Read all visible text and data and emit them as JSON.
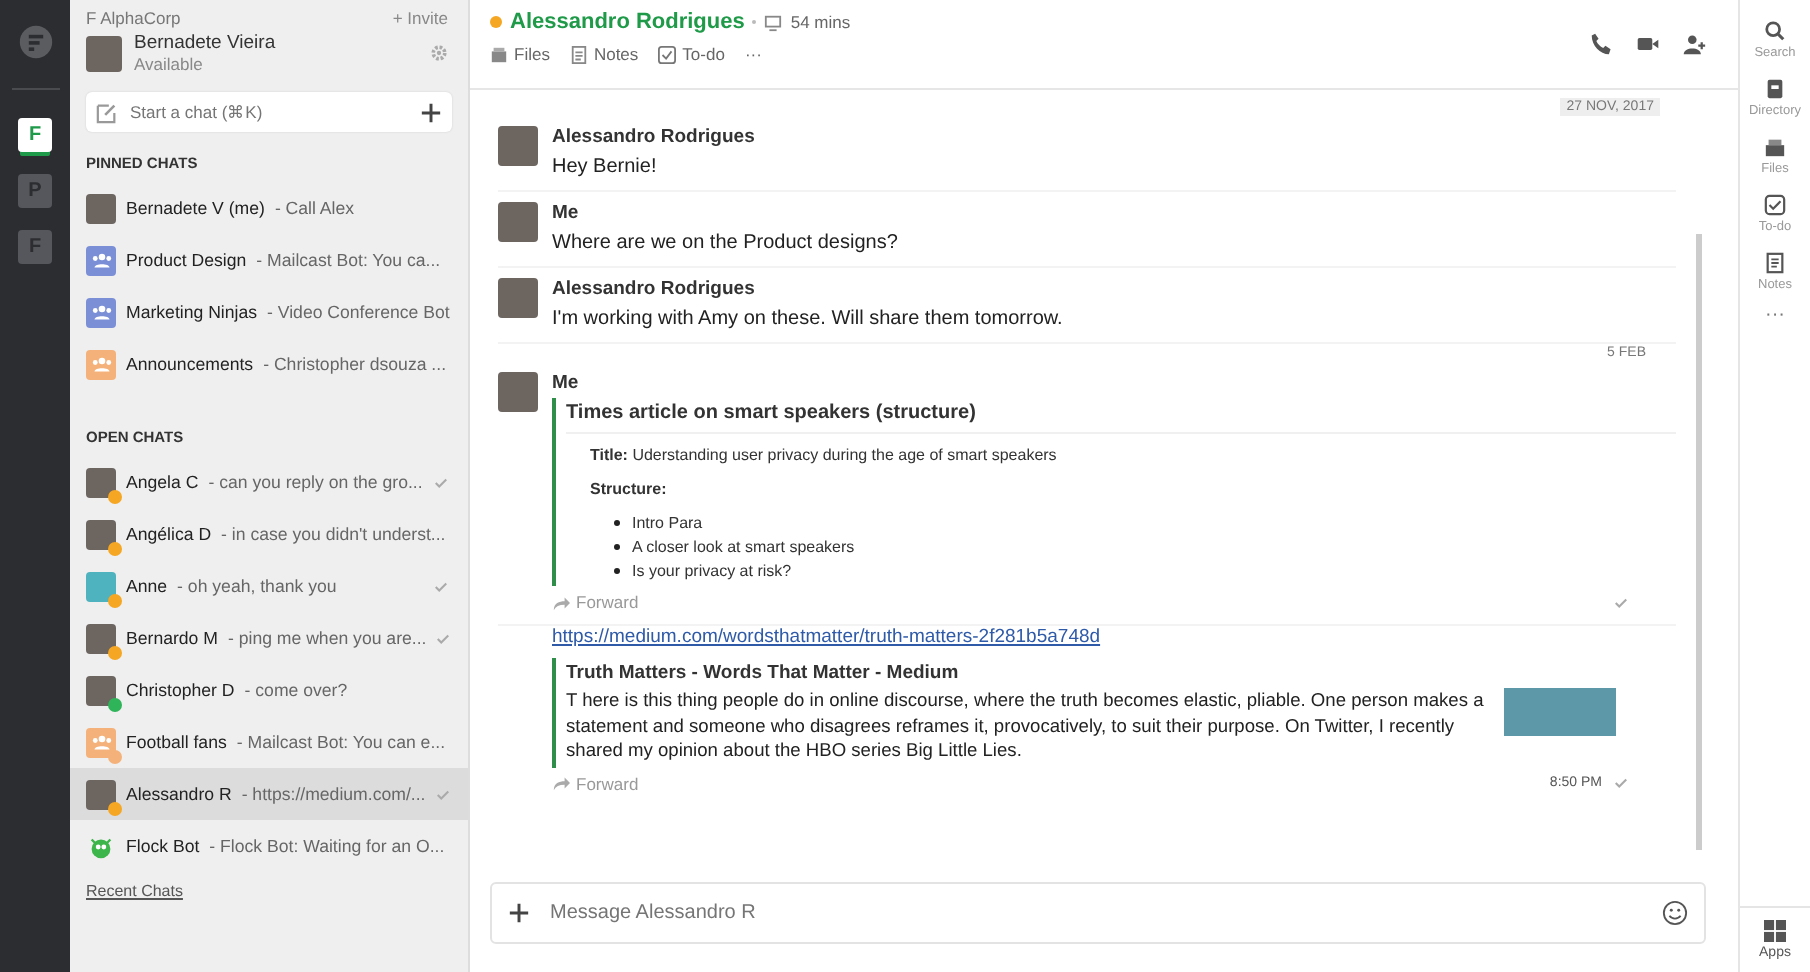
{
  "teams": [
    {
      "letter": "F",
      "selected": true
    },
    {
      "letter": "P",
      "selected": false
    },
    {
      "letter": "F",
      "selected": false
    }
  ],
  "sidebar": {
    "org": "F AlphaCorp",
    "invite": "+ Invite",
    "user": {
      "name": "Bernadete Vieira",
      "status": "Available"
    },
    "search": {
      "placeholder": "Start a chat (⌘K)"
    },
    "pinned_heading": "PINNED CHATS",
    "pinned": [
      {
        "kind": "person",
        "name": "Bernadete V (me)",
        "preview": "- Call Alex"
      },
      {
        "kind": "group",
        "color": "#7b8fd6",
        "name": "Product Design",
        "preview": "- Mailcast Bot: You ca..."
      },
      {
        "kind": "group",
        "color": "#7b8fd6",
        "name": "Marketing Ninjas",
        "preview": "- Video Conference Bot"
      },
      {
        "kind": "group",
        "color": "#f4b27a",
        "name": "Announcements",
        "preview": "- Christopher dsouza ..."
      }
    ],
    "open_heading": "OPEN CHATS",
    "open": [
      {
        "kind": "person",
        "name": "Angela C",
        "preview": "- can you reply on the gro...",
        "color": "#f5a623",
        "read": true,
        "selected": false
      },
      {
        "kind": "person",
        "name": "Angélica D",
        "preview": "- in case you didn't underst...",
        "color": "#f5a623",
        "read": false,
        "selected": false
      },
      {
        "kind": "bot",
        "name": "Anne",
        "preview": "- oh yeah, thank you",
        "color": "#f5a623",
        "read": true,
        "selected": false
      },
      {
        "kind": "person",
        "name": "Bernardo M",
        "preview": "- ping me when you are...",
        "color": "#f5a623",
        "read": true,
        "selected": false
      },
      {
        "kind": "person",
        "name": "Christopher D",
        "preview": "- come over?",
        "color": "#2fb45a",
        "read": false,
        "selected": false
      },
      {
        "kind": "group",
        "name": "Football fans",
        "preview": "- Mailcast Bot: You can e...",
        "color": "#f4b27a",
        "read": false,
        "selected": false
      },
      {
        "kind": "person",
        "name": "Alessandro R",
        "preview": "- https://medium.com/...",
        "color": "#f5a623",
        "read": true,
        "selected": true
      },
      {
        "kind": "robot",
        "name": "Flock Bot",
        "preview": "- Flock Bot: Waiting for an O...",
        "read": false,
        "selected": false
      }
    ],
    "recent_link": "Recent Chats"
  },
  "header": {
    "name": "Alessandro Rodrigues",
    "color": "#f5a623",
    "duration": "54 mins",
    "tabs": [
      {
        "kind": "files",
        "label": "Files"
      },
      {
        "kind": "notes",
        "label": "Notes"
      },
      {
        "kind": "todo",
        "label": "To-do"
      },
      {
        "kind": "more",
        "label": "···"
      }
    ]
  },
  "messages": [
    {
      "kind": "date",
      "text": "27 NOV, 2017"
    },
    {
      "kind": "text",
      "sender": "Alessandro Rodrigues",
      "text": "Hey Bernie!"
    },
    {
      "kind": "text",
      "sender": "Me",
      "text": "Where are we on the Product designs?"
    },
    {
      "kind": "text",
      "sender": "Alessandro Rodrigues",
      "text": "I'm working with Amy on these. Will share them tomorrow."
    },
    {
      "kind": "date",
      "text": "5 FEB"
    },
    {
      "kind": "card",
      "sender": "Me",
      "title": "Times article on smart speakers (structure)",
      "line": "**Title:** Uderstanding user privacy during the age of smart speakers",
      "subheading": "Structure:",
      "bullets": [
        "Intro Para",
        "A closer look at smart speakers",
        "Is your privacy at risk?"
      ],
      "forward": "Forward",
      "read": true
    },
    {
      "kind": "link",
      "url": "https://medium.com/wordsthatmatter/truth-matters-2f281b5a748d",
      "title": "Truth Matters - Words That Matter - Medium",
      "description": "T here is this thing people do in online discourse, where the truth becomes elastic, pliable. One person makes a statement and someone who disagrees reframes it, provocatively, to suit their purpose. On Twitter, I recently shared my opinion about the HBO series Big Little Lies.",
      "forward": "Forward",
      "time": "8:50 PM",
      "read": true
    }
  ],
  "composer": {
    "placeholder": "Message Alessandro R"
  },
  "right_rail": [
    {
      "kind": "search",
      "label": "Search"
    },
    {
      "kind": "directory",
      "label": "Directory"
    },
    {
      "kind": "files",
      "label": "Files"
    },
    {
      "kind": "todo",
      "label": "To-do"
    },
    {
      "kind": "notes",
      "label": "Notes"
    },
    {
      "kind": "more",
      "label": "···"
    }
  ],
  "apps": {
    "label": "Apps"
  }
}
